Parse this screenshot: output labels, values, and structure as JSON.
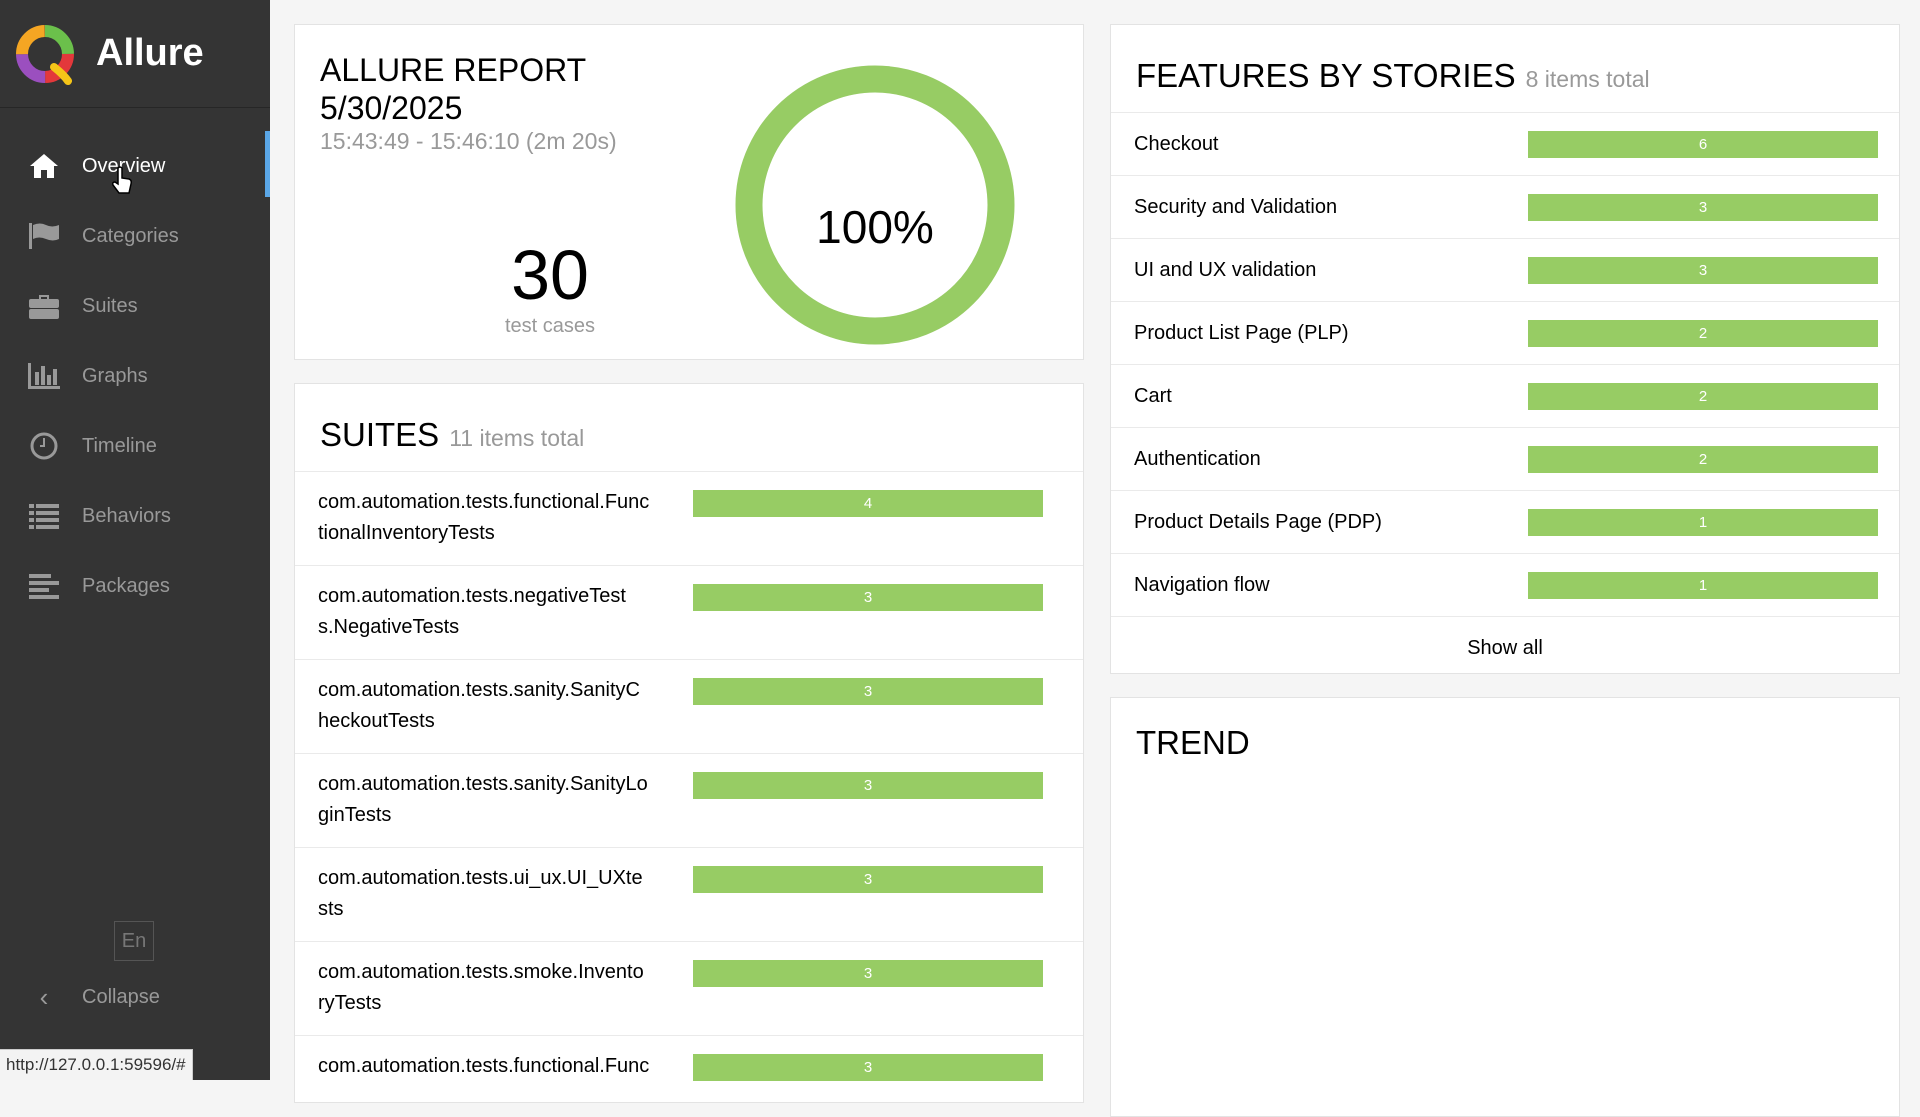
{
  "app": {
    "name": "Allure",
    "status_url": "http://127.0.0.1:59596/#",
    "lang": "En",
    "collapse_label": "Collapse"
  },
  "colors": {
    "passed": "#97cc64",
    "sidebar": "#343434",
    "active_indicator": "#5aa6e6"
  },
  "nav": [
    {
      "label": "Overview",
      "icon": "home-icon",
      "active": true
    },
    {
      "label": "Categories",
      "icon": "flag-icon"
    },
    {
      "label": "Suites",
      "icon": "briefcase-icon"
    },
    {
      "label": "Graphs",
      "icon": "bar-chart-icon"
    },
    {
      "label": "Timeline",
      "icon": "clock-icon"
    },
    {
      "label": "Behaviors",
      "icon": "list-icon"
    },
    {
      "label": "Packages",
      "icon": "align-left-icon"
    }
  ],
  "summary": {
    "title_line1": "ALLURE REPORT",
    "title_line2": "5/30/2025",
    "time_range": "15:43:49 - 15:46:10 (2m 20s)",
    "total": "30",
    "total_label": "test cases",
    "pass_rate": "100%",
    "pass_fraction": 1.0
  },
  "suites": {
    "title": "SUITES",
    "subtitle": "11 items total",
    "rows": [
      {
        "name_l1": "com.automation.tests.functional.Func",
        "name_l2": "tionalInventoryTests",
        "count": "4"
      },
      {
        "name_l1": "com.automation.tests.negativeTest",
        "name_l2": "s.NegativeTests",
        "count": "3"
      },
      {
        "name_l1": "com.automation.tests.sanity.SanityC",
        "name_l2": "heckoutTests",
        "count": "3"
      },
      {
        "name_l1": "com.automation.tests.sanity.SanityLo",
        "name_l2": "ginTests",
        "count": "3"
      },
      {
        "name_l1": "com.automation.tests.ui_ux.UI_UXte",
        "name_l2": "sts",
        "count": "3"
      },
      {
        "name_l1": "com.automation.tests.smoke.Invento",
        "name_l2": "ryTests",
        "count": "3"
      },
      {
        "name_l1": "com.automation.tests.functional.Func",
        "name_l2": "",
        "count": "3"
      }
    ]
  },
  "features": {
    "title": "FEATURES BY STORIES",
    "subtitle": "8 items total",
    "rows": [
      {
        "name": "Checkout",
        "count": "6"
      },
      {
        "name": "Security and Validation",
        "count": "3"
      },
      {
        "name": "UI and UX validation",
        "count": "3"
      },
      {
        "name": "Product List Page (PLP)",
        "count": "2"
      },
      {
        "name": "Cart",
        "count": "2"
      },
      {
        "name": "Authentication",
        "count": "2"
      },
      {
        "name": "Product Details Page (PDP)",
        "count": "1"
      },
      {
        "name": "Navigation flow",
        "count": "1"
      }
    ],
    "show_all": "Show all"
  },
  "trend": {
    "title": "TREND"
  }
}
